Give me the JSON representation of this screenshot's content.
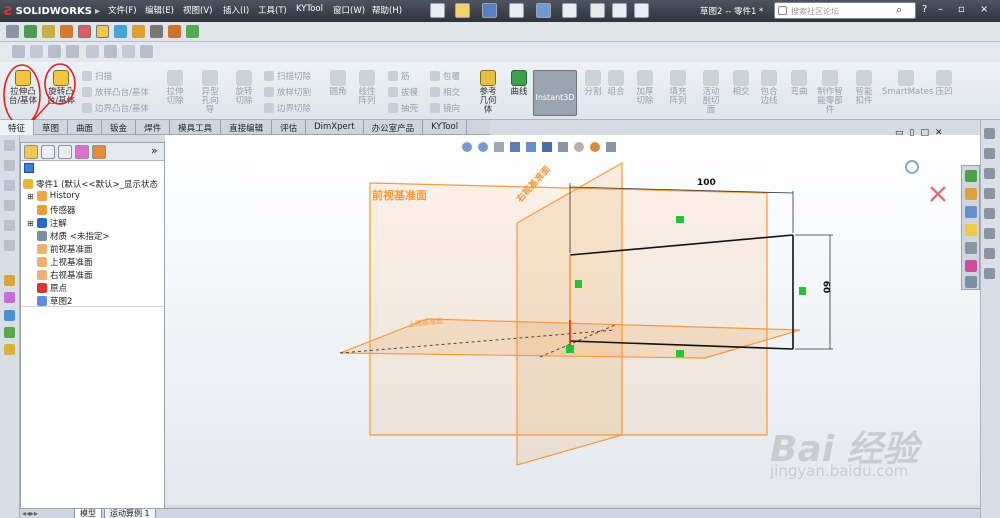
{
  "app": {
    "logo": "SOLIDWORKS",
    "doc_title": "草图2 -- 零件1 *"
  },
  "menu": [
    "文件(F)",
    "编辑(E)",
    "视图(V)",
    "插入(I)",
    "工具(T)",
    "KYTool",
    "窗口(W)",
    "帮助(H)"
  ],
  "search": {
    "placeholder": "搜索社区论坛"
  },
  "window_buttons": [
    "?",
    "–",
    "▫",
    "×"
  ],
  "command_manager": {
    "extrude_boss": "拉伸凸台/基体",
    "revolve_boss": "旋转凸台/基体",
    "sweep": "扫描",
    "loft": "放样凸台/基体",
    "boundary_boss": "边界凸台/基体",
    "extrude_cut": "拉伸切除",
    "hole_wizard": "异型孔向导",
    "revolve_cut": "旋转切除",
    "swept_cut": "扫描切除",
    "lofted_cut": "放样切割",
    "boundary_cut": "边界切除",
    "fillet": "圆角",
    "linear_pattern": "线性阵列",
    "rib": "筋",
    "draft": "拔模",
    "shell": "抽壳",
    "wrap": "包覆",
    "intersect": "相交",
    "mirror": "镜向",
    "reference_geometry": "参考几何体",
    "curves": "曲线",
    "instant3d": "Instant3D",
    "split": "分割",
    "combine": "组合",
    "thicken_cut": "加厚切除",
    "fill_pattern": "填充阵列",
    "live_section": "活动剖切面",
    "intersect2": "相交",
    "wrap_edge": "包合边线",
    "flex": "弯曲",
    "smart_part": "制作智能零部件",
    "smart_fastener": "智能扣件",
    "smartmates": "SmartMates",
    "indent": "压凹"
  },
  "tabs": [
    "特征",
    "草图",
    "曲面",
    "钣金",
    "焊件",
    "模具工具",
    "直接编辑",
    "评估",
    "DimXpert",
    "办公室产品",
    "KYTool"
  ],
  "feature_tree": {
    "root": "零件1 (默认<<默认>_显示状态",
    "items": [
      "History",
      "传感器",
      "注解",
      "材质 <未指定>",
      "前视基准面",
      "上视基准面",
      "右视基准面",
      "原点",
      "草图2"
    ]
  },
  "viewport": {
    "front_plane_label": "前视基准面",
    "right_plane_label": "右视基准面",
    "top_plane_label": "上视基准面",
    "dim_horizontal": "100",
    "dim_vertical": "60",
    "relation_horizontal": "—",
    "relation_vertical": "|"
  },
  "bottom_tabs": [
    "模型",
    "运动算例 1"
  ],
  "watermark": {
    "text": "Bai 经验",
    "url": "jingyan.baidu.com"
  },
  "colors": {
    "plane": "#f59a3c",
    "sketch_line": "#111111",
    "relation_green": "#22c33a",
    "annotation_red": "#e02020"
  }
}
